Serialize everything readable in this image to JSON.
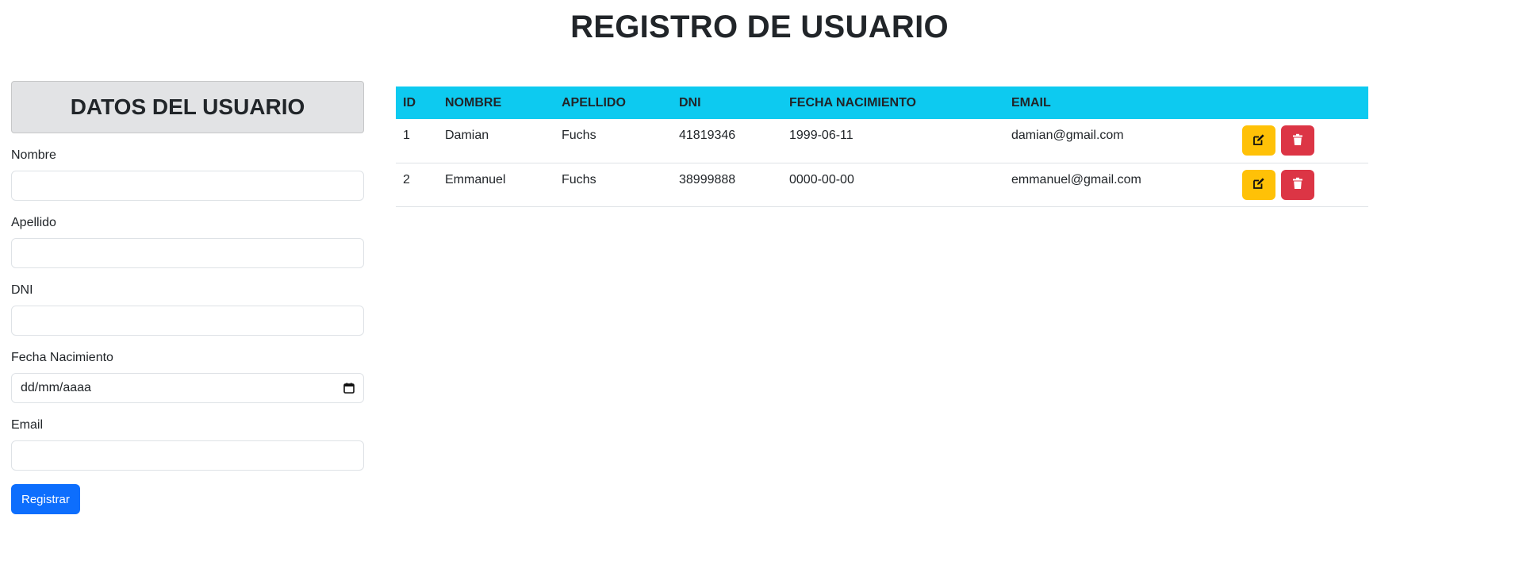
{
  "page": {
    "title": "REGISTRO DE USUARIO"
  },
  "form": {
    "header": "DATOS DEL USUARIO",
    "fields": [
      {
        "label": "Nombre",
        "value": ""
      },
      {
        "label": "Apellido",
        "value": ""
      },
      {
        "label": "DNI",
        "value": ""
      },
      {
        "label": "Fecha Nacimiento",
        "placeholder": "dd/mm/aaaa",
        "icon": "calendar-icon"
      },
      {
        "label": "Email",
        "value": ""
      }
    ],
    "submit_label": "Registrar"
  },
  "table": {
    "headers": [
      "ID",
      "NOMBRE",
      "APELLIDO",
      "DNI",
      "FECHA NACIMIENTO",
      "EMAIL",
      ""
    ],
    "rows": [
      {
        "id": "1",
        "nombre": "Damian",
        "apellido": "Fuchs",
        "dni": "41819346",
        "fecha": "1999-06-11",
        "email": "damian@gmail.com"
      },
      {
        "id": "2",
        "nombre": "Emmanuel",
        "apellido": "Fuchs",
        "dni": "38999888",
        "fecha": "0000-00-00",
        "email": "emmanuel@gmail.com"
      }
    ],
    "row_actions": [
      {
        "name": "edit-button",
        "icon": "edit-icon",
        "color": "#ffc107"
      },
      {
        "name": "delete-button",
        "icon": "trash-icon",
        "color": "#dc3545"
      }
    ]
  },
  "colors": {
    "header_bg": "#0dcaf0",
    "primary": "#0d6efd",
    "form_header_bg": "#e2e3e5"
  }
}
